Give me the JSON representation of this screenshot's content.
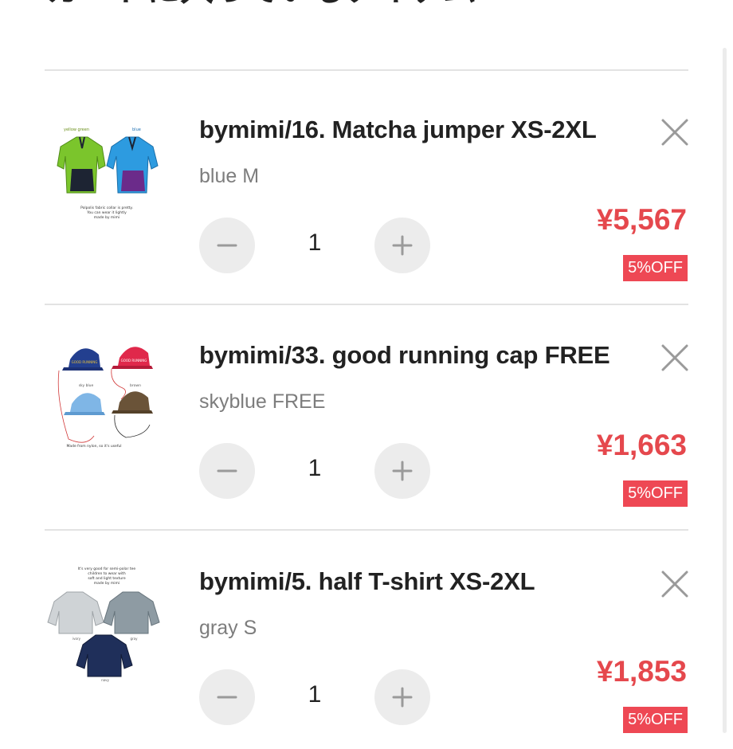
{
  "page": {
    "title": "カートに入っているアイテム"
  },
  "cart": {
    "items": [
      {
        "name": "bymimi/16. Matcha jumper XS-2XL",
        "variant": "blue M",
        "quantity": "1",
        "price": "¥5,567",
        "discount": "5%OFF",
        "thumb_labels": [
          "yellow green",
          "blue"
        ],
        "thumb_caption": [
          "Polpolis fabric collar is pretty.",
          "You can wear it lightly",
          "made by mimi"
        ]
      },
      {
        "name": "bymimi/33. good running cap FREE",
        "variant": "skyblue FREE",
        "quantity": "1",
        "price": "¥1,663",
        "discount": "5%OFF",
        "thumb_labels": [
          "sky blue",
          "brown"
        ],
        "thumb_caption": [
          "Made from nylon, so it's useful"
        ]
      },
      {
        "name": "bymimi/5. half T-shirt XS-2XL",
        "variant": "gray S",
        "quantity": "1",
        "price": "¥1,853",
        "discount": "5%OFF",
        "thumb_labels": [
          "ivory",
          "gray",
          "navy"
        ],
        "thumb_caption": [
          "It's very good for semi-polar tee",
          "children to wear with",
          "soft and light texture",
          "made by mimi"
        ]
      }
    ]
  },
  "icons": {
    "remove": "close-icon",
    "decrement": "minus-icon",
    "increment": "plus-icon"
  },
  "colors": {
    "price": "#e5484d",
    "badge_bg": "#ee4854",
    "qty_button_bg": "#ececec",
    "variant_text": "#7d7d7d"
  }
}
